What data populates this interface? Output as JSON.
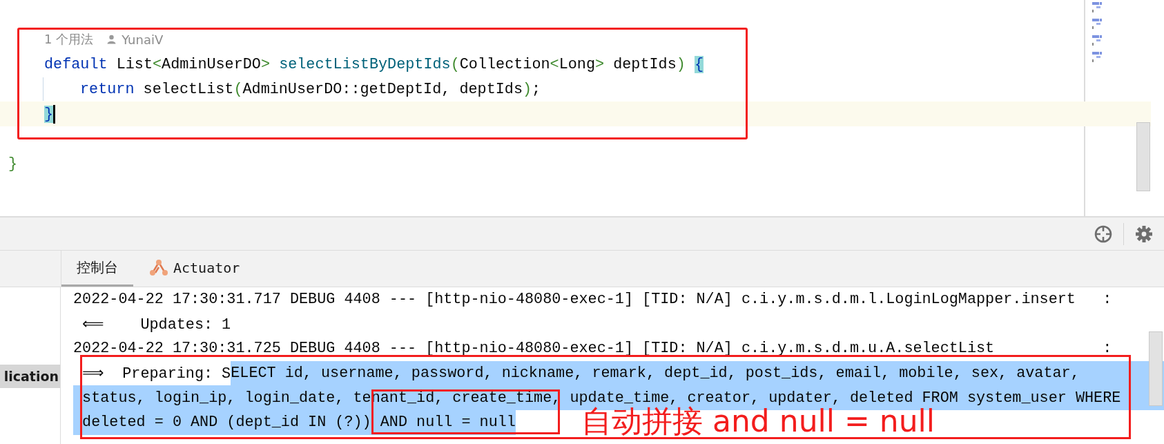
{
  "editor": {
    "usage_hint": "1 个用法",
    "author": "YunaiV",
    "method": {
      "signature": [
        {
          "text": "default",
          "kind": "keyword"
        },
        {
          "text": " List",
          "kind": "plain"
        },
        {
          "text": "<",
          "kind": "bracket"
        },
        {
          "text": "AdminUserDO",
          "kind": "plain"
        },
        {
          "text": "> ",
          "kind": "bracket"
        },
        {
          "text": "selectListByDeptIds",
          "kind": "method"
        },
        {
          "text": "(",
          "kind": "bracket"
        },
        {
          "text": "Collection",
          "kind": "plain"
        },
        {
          "text": "<",
          "kind": "bracket"
        },
        {
          "text": "Long",
          "kind": "plain"
        },
        {
          "text": ">",
          "kind": "bracket"
        },
        {
          "text": " deptIds",
          "kind": "plain"
        },
        {
          "text": ") ",
          "kind": "bracket"
        },
        {
          "text": "{",
          "kind": "matched_brace"
        }
      ],
      "body": [
        {
          "tokens": [
            {
              "text": "return",
              "kind": "keyword"
            },
            {
              "text": " selectList",
              "kind": "plain"
            },
            {
              "text": "(",
              "kind": "bracket"
            },
            {
              "text": "AdminUserDO::getDeptId, deptIds",
              "kind": "plain"
            },
            {
              "text": ")",
              "kind": "bracket"
            },
            {
              "text": ";",
              "kind": "plain"
            }
          ]
        }
      ],
      "closing": {
        "current": true,
        "tokens": [
          {
            "text": "}",
            "kind": "matched_brace"
          }
        ]
      }
    },
    "class_closing": {
      "tokens": [
        {
          "text": "}",
          "kind": "bracket"
        }
      ]
    }
  },
  "console": {
    "tabs": [
      {
        "label": "控制台",
        "selected": true,
        "kind": "text"
      },
      {
        "label": "Actuator",
        "selected": false,
        "kind": "actuator"
      }
    ],
    "side_label": "lication",
    "lines": [
      {
        "trailing": ":",
        "eol_selected": false,
        "parts": [
          {
            "text": "2022-04-22 17:30:31.717 DEBUG 4408 --- [http-nio-48080-exec-1] [TID: N/A] c.i.y.m.s.d.m.l.LoginLogMapper.insert",
            "selected": false
          }
        ]
      },
      {
        "eol_selected": false,
        "parts": [
          {
            "text": " ⟸    Updates: 1",
            "selected": false
          }
        ]
      },
      {
        "trailing": ":",
        "eol_selected": false,
        "parts": [
          {
            "text": "2022-04-22 17:30:31.725 DEBUG 4408 --- [http-nio-48080-exec-1] [TID: N/A] c.i.y.m.s.d.m.u.A.selectList",
            "selected": false
          }
        ]
      },
      {
        "eol_selected": true,
        "parts": [
          {
            "text": " ⟹  Preparing: S",
            "selected": false
          },
          {
            "text": "ELECT id, username, password, nickname, remark, dept_id, post_ids, email, mobile, sex, avatar,",
            "selected": true
          }
        ]
      },
      {
        "eol_selected": true,
        "parts": [
          {
            "text": " status, login_ip, login_date, tenant_id, create_time, update_time, creator, updater, deleted FROM system_user WHERE",
            "selected": true
          }
        ]
      },
      {
        "eol_selected": false,
        "parts": [
          {
            "text": " deleted = 0 AND (dept_id IN (?)) AND null = null",
            "selected": true
          }
        ]
      }
    ]
  },
  "annotation": {
    "text": "自动拼接 and null = null"
  }
}
